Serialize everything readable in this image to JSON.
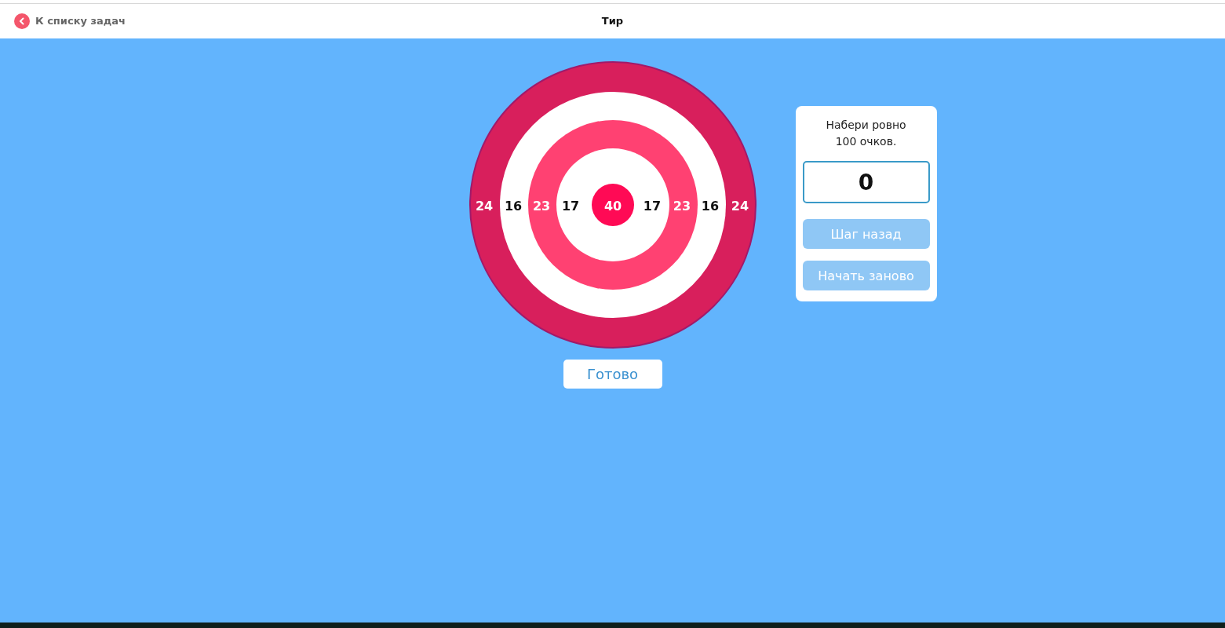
{
  "header": {
    "back_link": "К списку задач",
    "title": "Тир"
  },
  "target": {
    "rings": [
      {
        "color": "#d81f5c"
      },
      {
        "color": "#ffffff"
      },
      {
        "color": "#ff4172"
      },
      {
        "color": "#ffffff"
      },
      {
        "color": "#ff0a55"
      }
    ],
    "labels": [
      {
        "text": "24"
      },
      {
        "text": "16"
      },
      {
        "text": "23"
      },
      {
        "text": "17"
      },
      {
        "text": "40"
      },
      {
        "text": "17"
      },
      {
        "text": "23"
      },
      {
        "text": "16"
      },
      {
        "text": "24"
      }
    ]
  },
  "panel": {
    "task": "Набери ровно 100 очков.",
    "score": "0",
    "buttons": [
      {
        "label": "Шаг назад",
        "disabled": true
      },
      {
        "label": "Начать заново",
        "disabled": true
      }
    ]
  },
  "done_button": "Готово"
}
